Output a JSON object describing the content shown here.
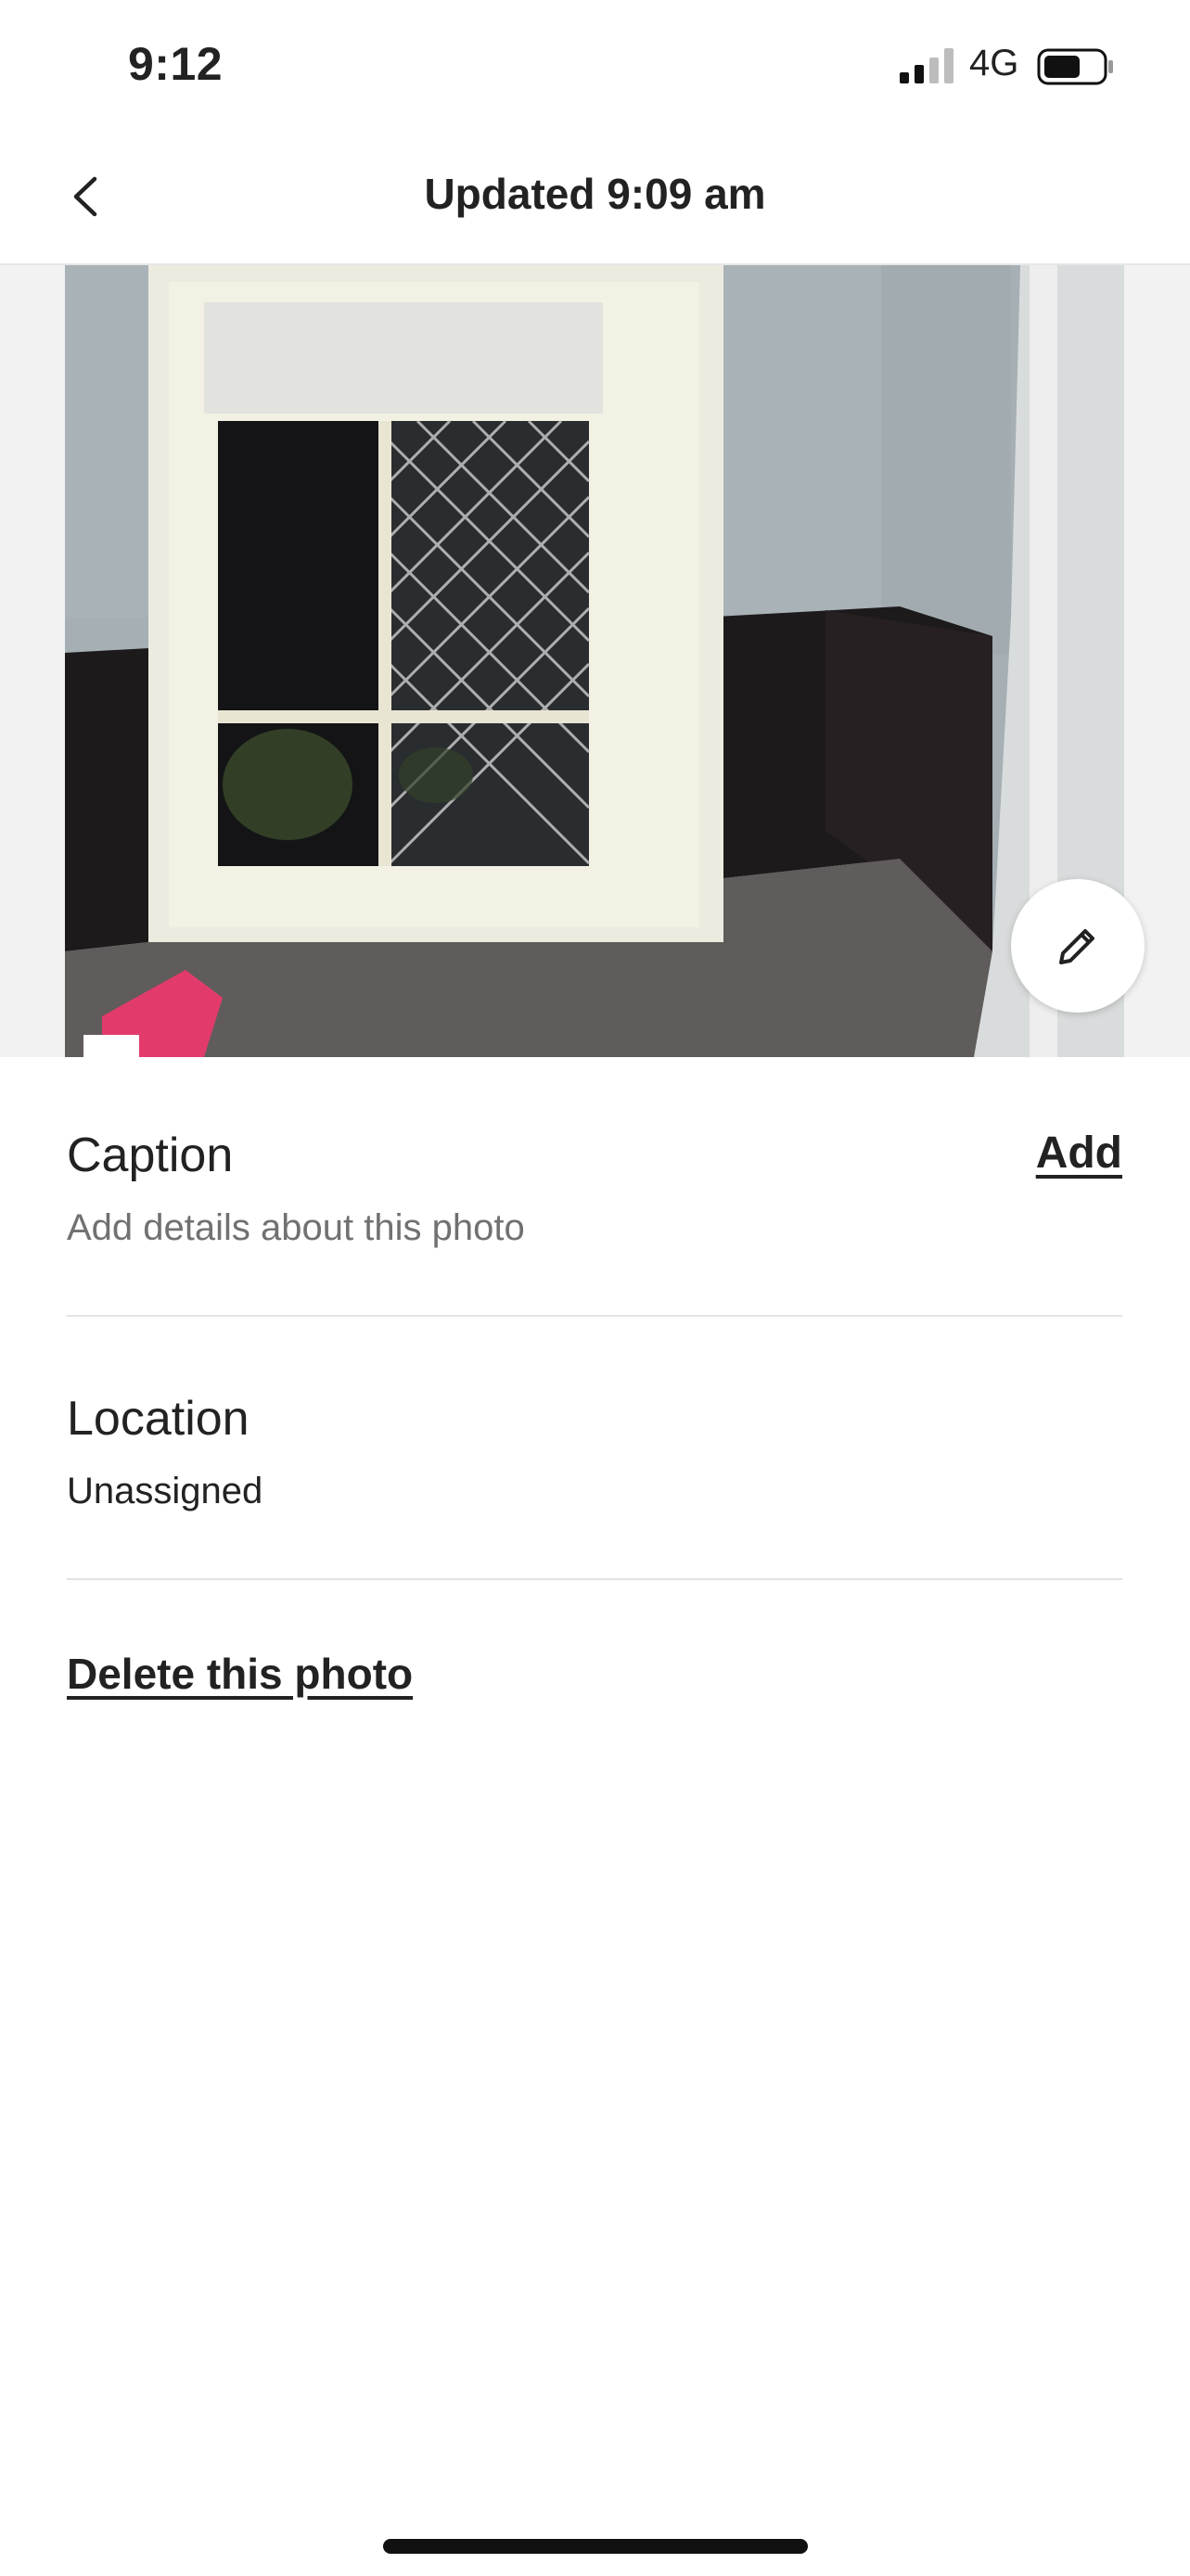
{
  "status_bar": {
    "time": "9:12",
    "network": "4G",
    "signal_icon": "cellular-signal-icon",
    "battery_icon": "battery-icon"
  },
  "header": {
    "title": "Updated 9:09 am",
    "back_icon": "chevron-left-icon"
  },
  "photo": {
    "description_icon": "room-photo",
    "edit_icon": "pencil-icon"
  },
  "caption": {
    "label": "Caption",
    "placeholder": "Add details about this photo",
    "action": "Add"
  },
  "location": {
    "label": "Location",
    "value": "Unassigned"
  },
  "delete": {
    "label": "Delete this photo"
  },
  "colors": {
    "text": "#222222",
    "muted": "#717171",
    "divider": "#e4e4e4"
  }
}
